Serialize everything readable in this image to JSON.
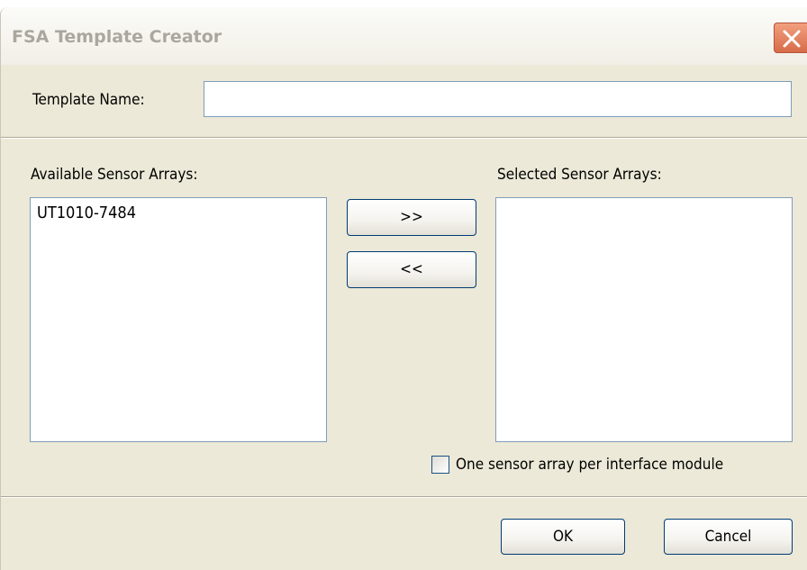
{
  "window": {
    "title": "FSA Template Creator",
    "close_glyph": "✕"
  },
  "template_name": {
    "label": "Template Name:",
    "value": ""
  },
  "available": {
    "label": "Available Sensor Arrays:",
    "items": [
      "UT1010-7484"
    ]
  },
  "selected": {
    "label": "Selected Sensor Arrays:",
    "items": []
  },
  "transfer": {
    "add_label": ">>",
    "remove_label": "<<"
  },
  "option": {
    "label": "One sensor array per interface module",
    "checked": false
  },
  "footer": {
    "ok_label": "OK",
    "cancel_label": "Cancel"
  },
  "colors": {
    "dialog_bg": "#ECE9D8",
    "close_button": "#D66B4A",
    "button_border": "#003C74",
    "input_border": "#7F9DB9",
    "title_text": "#A9A79E"
  }
}
